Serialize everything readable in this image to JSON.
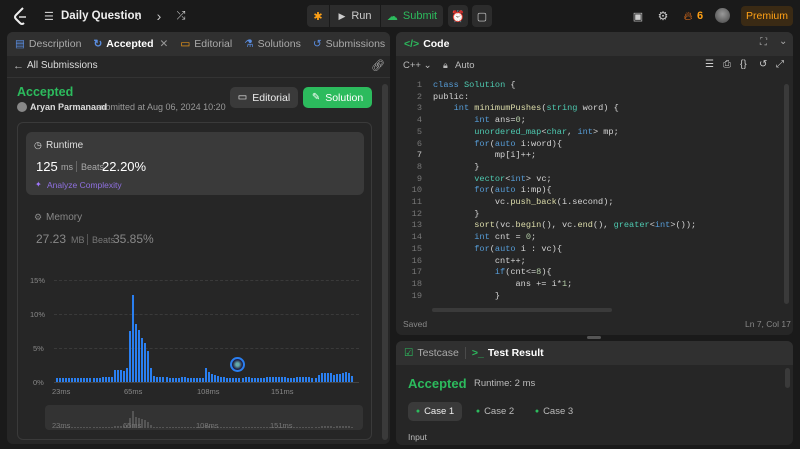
{
  "nav": {
    "title": "Daily Question",
    "run": "Run",
    "submit": "Submit",
    "streak": "6",
    "premium": "Premium"
  },
  "left": {
    "tabs": [
      {
        "label": "Description"
      },
      {
        "label": "Accepted"
      },
      {
        "label": "Editorial"
      },
      {
        "label": "Solutions"
      },
      {
        "label": "Submissions"
      }
    ],
    "back": "All Submissions",
    "status": "Accepted",
    "author": "Aryan Parmanand",
    "submitted": "submitted at Aug 06, 2024 10:20",
    "editorial_btn": "Editorial",
    "solution_btn": "Solution",
    "runtime": {
      "label": "Runtime",
      "value": "125",
      "unit": "ms",
      "beats_label": "Beats",
      "beats": "22.20%",
      "analyze": "Analyze Complexity"
    },
    "memory": {
      "label": "Memory",
      "value": "27.23",
      "unit": "MB",
      "beats_label": "Beats",
      "beats": "35.85%"
    }
  },
  "chart_data": {
    "type": "bar",
    "title": "",
    "xlabel": "",
    "ylabel": "",
    "yticks": [
      "15%",
      "10%",
      "5%",
      "0%"
    ],
    "ylim": [
      0,
      15
    ],
    "xticks": [
      "23ms",
      "65ms",
      "108ms",
      "151ms"
    ],
    "values": [
      0.6,
      0.6,
      0.6,
      0.6,
      0.6,
      0.6,
      0.6,
      0.6,
      0.6,
      0.6,
      0.6,
      0.6,
      0.6,
      0.6,
      0.6,
      0.7,
      0.7,
      0.8,
      0.8,
      1.8,
      1.8,
      1.7,
      1.6,
      2.1,
      7.5,
      12.8,
      8.5,
      7.7,
      6.5,
      5.7,
      4.5,
      2.0,
      0.9,
      0.7,
      0.7,
      0.7,
      0.7,
      0.6,
      0.6,
      0.6,
      0.6,
      0.7,
      0.7,
      0.6,
      0.6,
      0.6,
      0.6,
      0.6,
      0.6,
      2.1,
      1.5,
      1.2,
      1.0,
      0.9,
      0.8,
      0.7,
      0.6,
      0.6,
      0.6,
      0.6,
      0.6,
      0.6,
      0.7,
      0.7,
      0.6,
      0.6,
      0.6,
      0.6,
      0.6,
      0.7,
      0.7,
      0.7,
      0.7,
      0.7,
      0.7,
      0.7,
      0.6,
      0.6,
      0.6,
      0.7,
      0.7,
      0.8,
      0.8,
      0.7,
      0.6,
      0.6,
      1.0,
      1.3,
      1.4,
      1.4,
      1.3,
      1.0,
      1.2,
      1.2,
      1.4,
      1.5,
      1.3,
      0.9
    ]
  },
  "code": {
    "lang": "C++",
    "auto": "Auto",
    "header": "Code",
    "saved": "Saved",
    "position": "Ln 7, Col 17",
    "lines": [
      "class Solution {",
      "public:",
      "    int minimumPushes(string word) {",
      "        int ans=0;",
      "        unordered_map<char, int> mp;",
      "        for(auto i:word){",
      "            mp[i]++;",
      "        }",
      "        vector<int> vc;",
      "        for(auto i:mp){",
      "            vc.push_back(i.second);",
      "        }",
      "        sort(vc.begin(), vc.end(), greater<int>());",
      "        int cnt = 0;",
      "        for(auto i : vc){",
      "            cnt++;",
      "            if(cnt<=8){",
      "                ans += i*1;",
      "            }"
    ]
  },
  "result": {
    "tab1": "Testcase",
    "tab2": "Test Result",
    "status": "Accepted",
    "runtime": "Runtime: 2 ms",
    "cases": [
      "Case 1",
      "Case 2",
      "Case 3"
    ],
    "input_label": "Input"
  },
  "colors": {
    "accent_green": "#2cbb5d",
    "bar_blue": "#2a7ff0",
    "premium": "#ffa116"
  }
}
